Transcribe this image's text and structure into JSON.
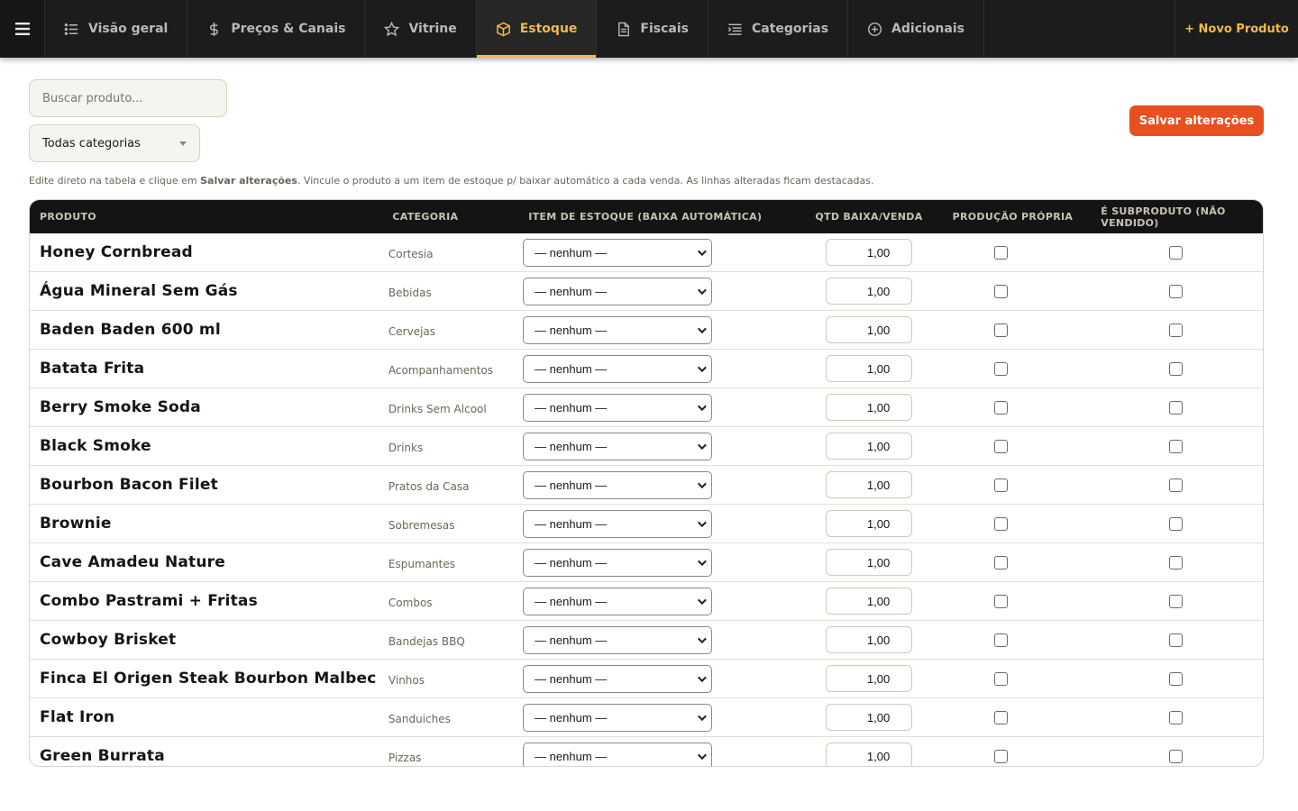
{
  "topbar": {
    "tabs": [
      {
        "label": "Visão geral",
        "icon": "list-icon"
      },
      {
        "label": "Preços & Canais",
        "icon": "dollar-icon"
      },
      {
        "label": "Vitrine",
        "icon": "star-icon"
      },
      {
        "label": "Estoque",
        "icon": "box-icon",
        "active": true
      },
      {
        "label": "Fiscais",
        "icon": "document-icon"
      },
      {
        "label": "Categorias",
        "icon": "list-indent-icon"
      },
      {
        "label": "Adicionais",
        "icon": "plus-circle-icon"
      }
    ],
    "new_product_label": "+ Novo Produto",
    "accent": "#f2b94a"
  },
  "filters": {
    "search_placeholder": "Buscar produto...",
    "category_value": "Todas categorias"
  },
  "actions": {
    "save_label": "Salvar alterações",
    "save_color": "#e8501f"
  },
  "hint": {
    "prefix": "Edite direto na tabela e clique em ",
    "bold": "Salvar alterações",
    "suffix": ". Vincule o produto a um item de estoque p/ baixar automático a cada venda. As linhas alteradas ficam destacadas."
  },
  "table": {
    "headers": {
      "produto": "PRODUTO",
      "categoria": "CATEGORIA",
      "item_estoque": "ITEM DE ESTOQUE (BAIXA AUTOMÁTICA)",
      "qtd": "QTD BAIXA/VENDA",
      "producao": "PRODUÇÃO PRÓPRIA",
      "subproduto": "É SUBPRODUTO (NÃO VENDIDO)"
    },
    "rows": [
      {
        "name": "Honey Cornbread",
        "category": "Cortesia",
        "stock_item": "— nenhum —",
        "qty": "1,00",
        "own_production": false,
        "byproduct": false
      },
      {
        "name": "Água Mineral Sem Gás",
        "category": "Bebidas",
        "stock_item": "— nenhum —",
        "qty": "1,00",
        "own_production": false,
        "byproduct": false
      },
      {
        "name": "Baden Baden 600 ml",
        "category": "Cervejas",
        "stock_item": "— nenhum —",
        "qty": "1,00",
        "own_production": false,
        "byproduct": false
      },
      {
        "name": "Batata Frita",
        "category": "Acompanhamentos",
        "stock_item": "— nenhum —",
        "qty": "1,00",
        "own_production": false,
        "byproduct": false
      },
      {
        "name": "Berry Smoke Soda",
        "category": "Drinks Sem Alcool",
        "stock_item": "— nenhum —",
        "qty": "1,00",
        "own_production": false,
        "byproduct": false
      },
      {
        "name": "Black Smoke",
        "category": "Drinks",
        "stock_item": "— nenhum —",
        "qty": "1,00",
        "own_production": false,
        "byproduct": false
      },
      {
        "name": "Bourbon Bacon Filet",
        "category": "Pratos da Casa",
        "stock_item": "— nenhum —",
        "qty": "1,00",
        "own_production": false,
        "byproduct": false
      },
      {
        "name": "Brownie",
        "category": "Sobremesas",
        "stock_item": "— nenhum —",
        "qty": "1,00",
        "own_production": false,
        "byproduct": false
      },
      {
        "name": "Cave Amadeu Nature",
        "category": "Espumantes",
        "stock_item": "— nenhum —",
        "qty": "1,00",
        "own_production": false,
        "byproduct": false
      },
      {
        "name": "Combo Pastrami + Fritas",
        "category": "Combos",
        "stock_item": "— nenhum —",
        "qty": "1,00",
        "own_production": false,
        "byproduct": false
      },
      {
        "name": "Cowboy Brisket",
        "category": "Bandejas BBQ",
        "stock_item": "— nenhum —",
        "qty": "1,00",
        "own_production": false,
        "byproduct": false
      },
      {
        "name": "Finca El Origen Steak Bourbon Malbec",
        "category": "Vinhos",
        "stock_item": "— nenhum —",
        "qty": "1,00",
        "own_production": false,
        "byproduct": false
      },
      {
        "name": "Flat Iron",
        "category": "Sanduiches",
        "stock_item": "— nenhum —",
        "qty": "1,00",
        "own_production": false,
        "byproduct": false
      },
      {
        "name": "Green Burrata",
        "category": "Pizzas",
        "stock_item": "— nenhum —",
        "qty": "1,00",
        "own_production": false,
        "byproduct": false
      }
    ]
  }
}
